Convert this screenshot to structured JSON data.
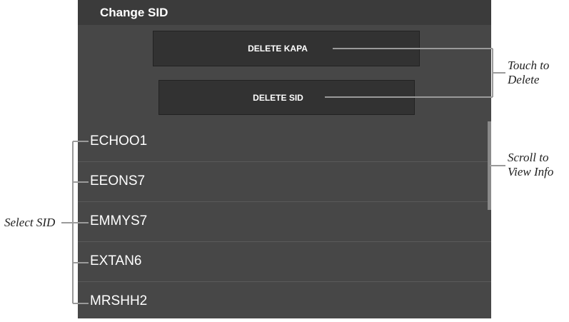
{
  "header": {
    "title": "Change SID"
  },
  "buttons": {
    "delete_kapa": "DELETE KAPA",
    "delete_sid": "DELETE SID"
  },
  "sid_list": [
    "ECHOO1",
    "EEONS7",
    "EMMYS7",
    "EXTAN6",
    "MRSHH2"
  ],
  "annotations": {
    "touch_line1": "Touch to",
    "touch_line2": "Delete",
    "scroll_line1": "Scroll to",
    "scroll_line2": "View Info",
    "select": "Select SID"
  }
}
